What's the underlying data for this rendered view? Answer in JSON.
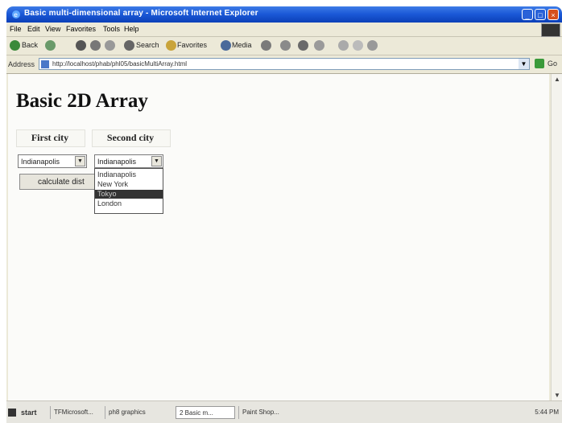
{
  "window": {
    "title": "Basic multi-dimensional array - Microsoft Internet Explorer"
  },
  "menubar": {
    "items": [
      "File",
      "Edit",
      "View",
      "Favorites",
      "Tools",
      "Help"
    ]
  },
  "toolbar": {
    "back_label": "Back",
    "search_label": "Search",
    "favorites_label": "Favorites",
    "media_label": "Media"
  },
  "addressbar": {
    "label": "Address",
    "url": "http://localhost/phab/phl05/basicMultiArray.html",
    "go_label": "Go"
  },
  "page": {
    "heading": "Basic 2D Array",
    "col1_header": "First city",
    "col2_header": "Second city",
    "select1_value": "Indianapolis",
    "select2_value": "Indianapolis",
    "button_label": "calculate dist",
    "dropdown_options": [
      "Indianapolis",
      "New York",
      "Tokyo",
      "London"
    ],
    "dropdown_selected": "Tokyo"
  },
  "taskbar": {
    "start_label": "start",
    "tasks": [
      "TFMicrosoft...",
      "ph8 graphics",
      "2 Basic m...",
      "Paint Shop..."
    ],
    "clock": "5:44 PM"
  }
}
